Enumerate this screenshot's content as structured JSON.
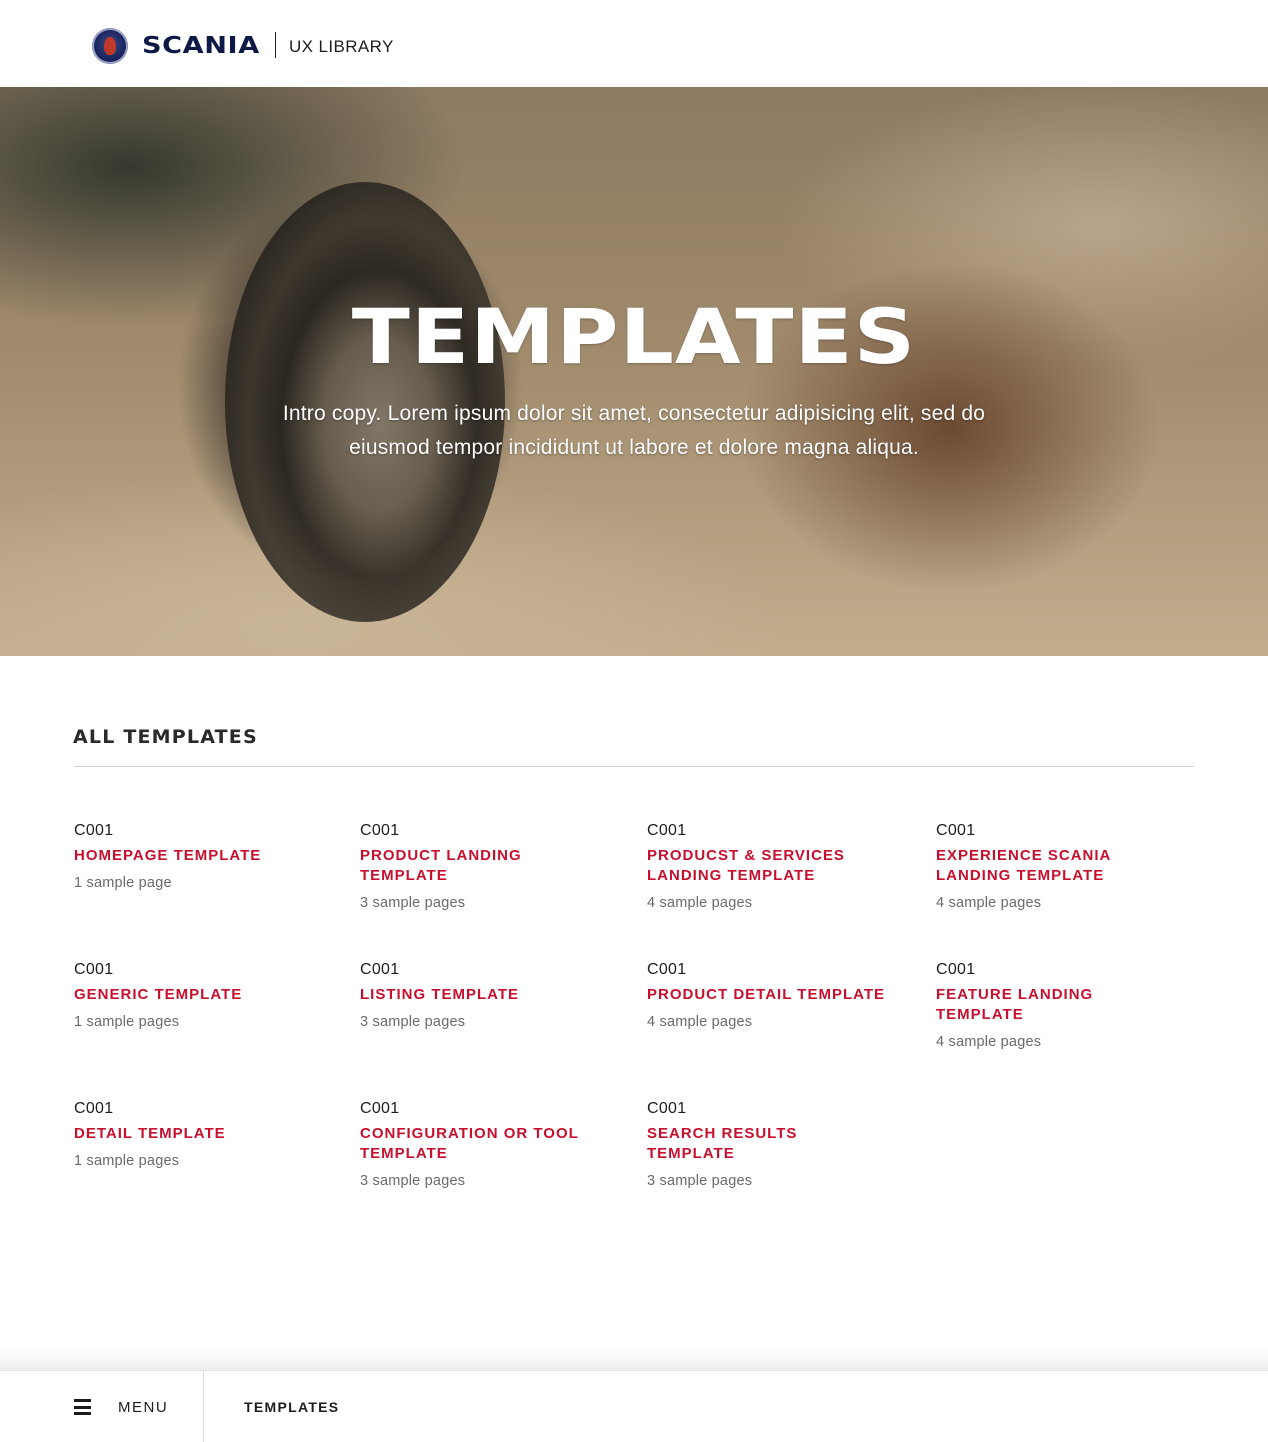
{
  "header": {
    "brand": "SCANIA",
    "product": "UX LIBRARY"
  },
  "hero": {
    "title": "TEMPLATES",
    "intro": "Intro copy. Lorem ipsum dolor sit amet, consectetur adipisicing elit, sed do eiusmod tempor incididunt ut labore et dolore magna aliqua."
  },
  "section": {
    "title": "ALL TEMPLATES"
  },
  "templates": [
    {
      "code": "C001",
      "name": "HOMEPAGE TEMPLATE",
      "count": "1 sample page"
    },
    {
      "code": "C001",
      "name": "PRODUCT LANDING TEMPLATE",
      "count": "3 sample pages"
    },
    {
      "code": "C001",
      "name": "PRODUCST & SERVICES LANDING TEMPLATE",
      "count": "4 sample pages"
    },
    {
      "code": "C001",
      "name": "EXPERIENCE SCANIA LANDING TEMPLATE",
      "count": "4 sample pages"
    },
    {
      "code": "C001",
      "name": "GENERIC TEMPLATE",
      "count": "1 sample pages"
    },
    {
      "code": "C001",
      "name": "LISTING TEMPLATE",
      "count": "3 sample pages"
    },
    {
      "code": "C001",
      "name": "PRODUCT DETAIL TEMPLATE",
      "count": "4 sample pages"
    },
    {
      "code": "C001",
      "name": "FEATURE LANDING TEMPLATE",
      "count": "4 sample pages"
    },
    {
      "code": "C001",
      "name": "DETAIL TEMPLATE",
      "count": "1 sample pages"
    },
    {
      "code": "C001",
      "name": "CONFIGURATION OR TOOL TEMPLATE",
      "count": "3 sample pages"
    },
    {
      "code": "C001",
      "name": "SEARCH RESULTS TEMPLATE",
      "count": "3 sample pages"
    }
  ],
  "bottom_bar": {
    "menu_label": "MENU",
    "breadcrumb": "TEMPLATES"
  },
  "colors": {
    "accent": "#c8102e",
    "brand_navy": "#0f1946"
  },
  "icons": [
    "scania-griffin-logo-icon",
    "hamburger-menu-icon"
  ]
}
